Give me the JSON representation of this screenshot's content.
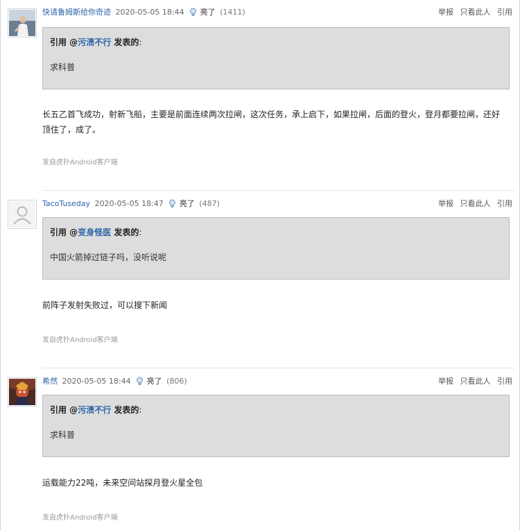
{
  "posts": [
    {
      "username": "快请鲁姆斯给你奇迹",
      "time": "2020-05-05 18:44",
      "light_label": "亮了",
      "light_count": "(1411)",
      "actions": {
        "report": "举报",
        "only_author": "只看此人",
        "quote": "引用"
      },
      "quote": {
        "prefix": "引用 @",
        "user": "污渍不行",
        "suffix": " 发表的",
        "colon": ":",
        "text": "求科普"
      },
      "content": "长五乙首飞成功，射新飞船，主要是前面连续两次拉闸，这次任务，承上启下，如果拉闸，后面的登火，登月都要拉闸，还好顶住了，成了。",
      "source": "发自虎扑Android客户端",
      "avatar_icon": "user-photo"
    },
    {
      "username": "TacoTuseday",
      "time": "2020-05-05 18:47",
      "light_label": "亮了",
      "light_count": "(487)",
      "actions": {
        "report": "举报",
        "only_author": "只看此人",
        "quote": "引用"
      },
      "quote": {
        "prefix": "引用 @",
        "user": "变身怪医",
        "suffix": " 发表的",
        "colon": ":",
        "text": "中国火箭掉过链子吗，没听说呢"
      },
      "content": "前阵子发射失败过，可以搜下新闻",
      "source": "发自虎扑Android客户端",
      "avatar_icon": "default-avatar"
    },
    {
      "username": "希然",
      "time": "2020-05-05 18:44",
      "light_label": "亮了",
      "light_count": "(806)",
      "actions": {
        "report": "举报",
        "only_author": "只看此人",
        "quote": "引用"
      },
      "quote": {
        "prefix": "引用 @",
        "user": "污渍不行",
        "suffix": " 发表的",
        "colon": ":",
        "text": "求科普"
      },
      "content": "运载能力22吨，未来空间站探月登火星全包",
      "source": "发自虎扑Android客户端",
      "avatar_icon": "user-photo"
    }
  ],
  "colors": {
    "link": "#2a64a8",
    "quote_bg": "#dddddd",
    "quote_border": "#bdbdbd"
  }
}
